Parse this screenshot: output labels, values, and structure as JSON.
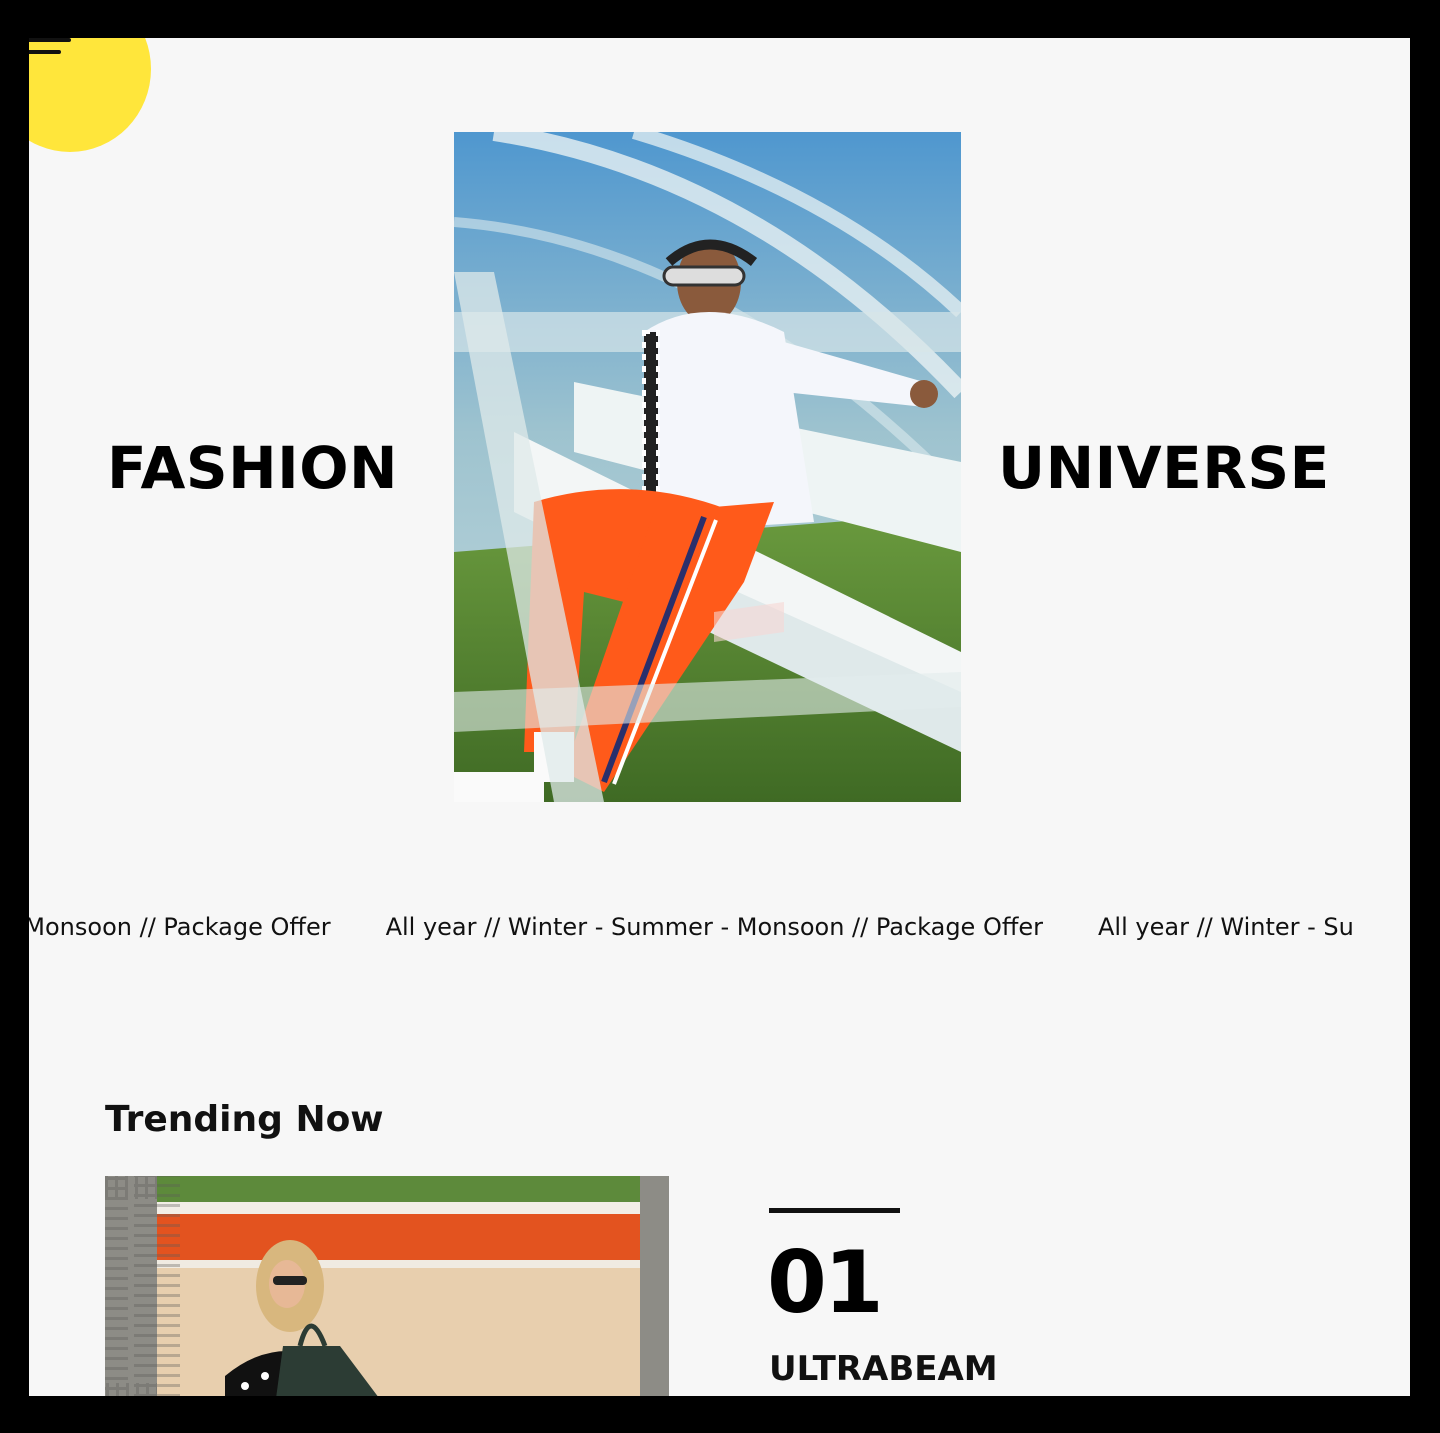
{
  "header": {
    "menu_icon": "hamburger-menu-icon",
    "accent_color": "#ffe63b"
  },
  "hero": {
    "left_word": "FASHION",
    "right_word": "UNIVERSE",
    "photo_alt": "man in sunglasses sitting on bench"
  },
  "marquee": {
    "items": [
      "- Monsoon // Package Offer",
      "All year // Winter - Summer - Monsoon // Package Offer",
      "All year // Winter - Su"
    ]
  },
  "trending": {
    "title": "Trending Now",
    "items": [
      {
        "number": "01",
        "name": "ULTRABEAM"
      }
    ]
  }
}
